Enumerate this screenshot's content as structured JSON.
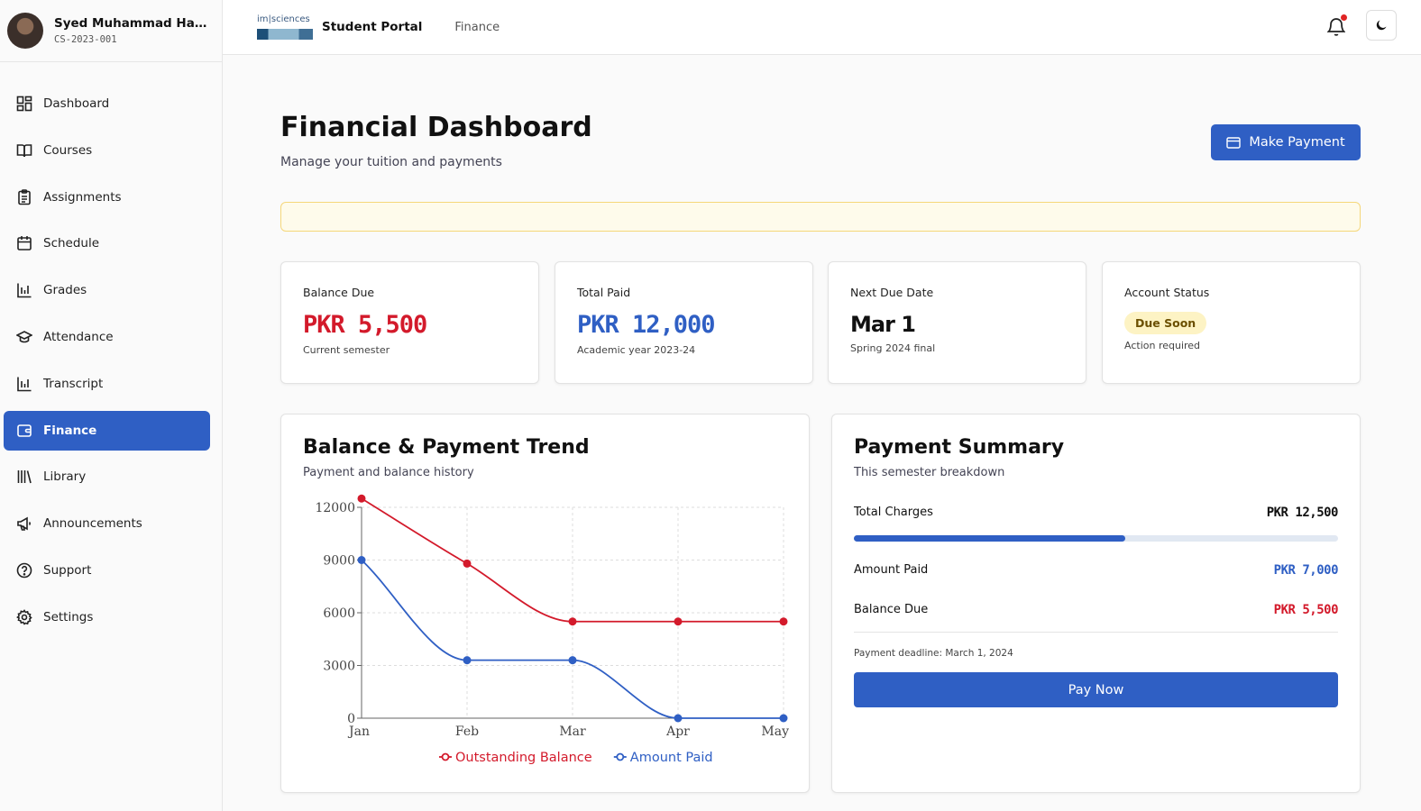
{
  "user": {
    "name": "Syed Muhammad Hamz...",
    "id": "CS-2023-001"
  },
  "sidebar": {
    "items": [
      {
        "label": "Dashboard",
        "icon": "dashboard-icon",
        "active": false
      },
      {
        "label": "Courses",
        "icon": "book-icon",
        "active": false
      },
      {
        "label": "Assignments",
        "icon": "clipboard-icon",
        "active": false
      },
      {
        "label": "Schedule",
        "icon": "calendar-icon",
        "active": false
      },
      {
        "label": "Grades",
        "icon": "bar-chart-icon",
        "active": false
      },
      {
        "label": "Attendance",
        "icon": "graduation-cap-icon",
        "active": false
      },
      {
        "label": "Transcript",
        "icon": "bar-chart-icon",
        "active": false
      },
      {
        "label": "Finance",
        "icon": "wallet-icon",
        "active": true
      },
      {
        "label": "Library",
        "icon": "library-icon",
        "active": false
      },
      {
        "label": "Announcements",
        "icon": "megaphone-icon",
        "active": false
      },
      {
        "label": "Support",
        "icon": "help-icon",
        "active": false
      },
      {
        "label": "Settings",
        "icon": "gear-icon",
        "active": false
      }
    ]
  },
  "header": {
    "logo_text": "im|sciences",
    "portal_title": "Student Portal",
    "breadcrumb": "Finance",
    "notification_dot": true
  },
  "page": {
    "title": "Financial Dashboard",
    "subtitle": "Manage your tuition and payments",
    "make_payment_label": "Make Payment"
  },
  "stats": [
    {
      "label": "Balance Due",
      "value": "PKR 5,500",
      "note": "Current semester",
      "color": "#d31a2b"
    },
    {
      "label": "Total Paid",
      "value": "PKR 12,000",
      "note": "Academic year 2023-24",
      "color": "#2f5fc4"
    },
    {
      "label": "Next Due Date",
      "value": "Mar 1",
      "note": "Spring 2024 final"
    },
    {
      "label": "Account Status",
      "badge": "Due Soon",
      "note": "Action required"
    }
  ],
  "trend_card": {
    "title": "Balance & Payment Trend",
    "subtitle": "Payment and balance history"
  },
  "chart_data": {
    "type": "line",
    "categories": [
      "Jan",
      "Feb",
      "Mar",
      "Apr",
      "May"
    ],
    "series": [
      {
        "name": "Outstanding Balance",
        "values": [
          12500,
          8800,
          5500,
          5500,
          5500
        ],
        "color": "#d31a2b"
      },
      {
        "name": "Amount Paid",
        "values": [
          9000,
          3300,
          3300,
          0,
          0
        ],
        "color": "#2f5fc4"
      }
    ],
    "y_ticks": [
      "0",
      "3000",
      "6000",
      "9000",
      "12000"
    ],
    "ylim": [
      0,
      12000
    ],
    "grid": true,
    "legend": "bottom"
  },
  "summary_card": {
    "title": "Payment Summary",
    "subtitle": "This semester breakdown",
    "total_charges_label": "Total Charges",
    "total_charges_value": "PKR 12,500",
    "progress_percent": 56,
    "amount_paid_label": "Amount Paid",
    "amount_paid_value": "PKR 7,000",
    "balance_due_label": "Balance Due",
    "balance_due_value": "PKR 5,500",
    "deadline": "Payment deadline: March 1, 2024",
    "pay_now_label": "Pay Now"
  }
}
